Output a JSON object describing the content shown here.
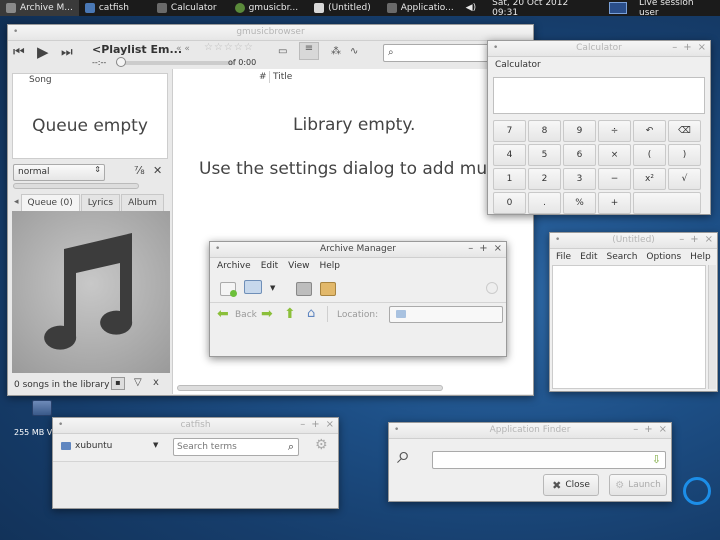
{
  "taskbar": {
    "tasks": [
      {
        "label": "Archive M...",
        "color": "#8a8a8a",
        "active": true
      },
      {
        "label": "catfish",
        "color": "#4a78b5",
        "active": false
      },
      {
        "label": "Calculator",
        "color": "#6a6a6a",
        "active": false
      },
      {
        "label": "gmusicbr...",
        "color": "#5a8a3a",
        "active": false
      },
      {
        "label": "(Untitled)",
        "color": "#d8d8d8",
        "active": false
      },
      {
        "label": "Applicatio...",
        "color": "#6a6a6a",
        "active": false
      }
    ],
    "clock": "Sat, 20 Oct 2012 09:31",
    "session": "Live session user"
  },
  "gmusicbrowser": {
    "title": "gmusicbrowser",
    "playlist": "<Playlist Em...",
    "time_left": "--:--",
    "time_right": "of 0:00",
    "search_placeholder": "",
    "queue_col": "Song",
    "queue_empty": "Queue empty",
    "mode": "normal",
    "tabs": [
      "Queue (0)",
      "Lyrics",
      "Album"
    ],
    "library_status": "0 songs in the library",
    "lib_col_num": "#",
    "lib_col_title": "Title",
    "library_empty": "Library empty.",
    "library_hint": "Use the settings dialog to add mus"
  },
  "calculator": {
    "title": "Calculator",
    "label": "Calculator",
    "display": "",
    "buttons": [
      [
        "7",
        "8",
        "9",
        "÷",
        "↶",
        "⌫"
      ],
      [
        "4",
        "5",
        "6",
        "×",
        "(",
        ")"
      ],
      [
        "1",
        "2",
        "3",
        "−",
        "x²",
        "√"
      ],
      [
        "0",
        ".",
        "%",
        "+",
        "",
        ""
      ]
    ]
  },
  "archive": {
    "title": "Archive Manager",
    "menu": [
      "Archive",
      "Edit",
      "View",
      "Help"
    ],
    "back": "Back",
    "location_label": "Location:",
    "location_value": ""
  },
  "mousepad": {
    "title": "(Untitled)",
    "menu": [
      "File",
      "Edit",
      "Search",
      "Options",
      "Help"
    ]
  },
  "desktop": {
    "drive_label": "255 MB V"
  },
  "catfish": {
    "title": "catfish",
    "folder": "xubuntu",
    "search_placeholder": "Search terms"
  },
  "appfinder": {
    "title": "Application Finder",
    "close": "Close",
    "launch": "Launch"
  }
}
